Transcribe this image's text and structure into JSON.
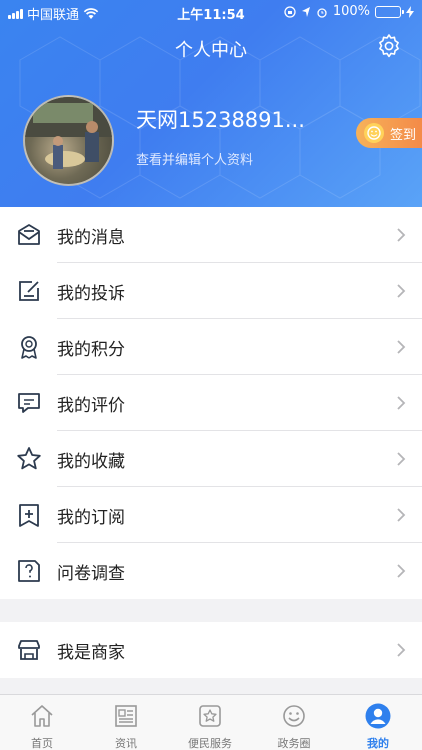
{
  "status_bar": {
    "carrier": "中国联通",
    "time": "上午11:54",
    "battery": "100%"
  },
  "header": {
    "title": "个人中心",
    "username": "天网15238891...",
    "edit_profile": "查看并编辑个人资料",
    "checkin_label": "签到"
  },
  "menu": {
    "items": [
      {
        "label": "我的消息",
        "icon": "message-icon"
      },
      {
        "label": "我的投诉",
        "icon": "complaint-icon"
      },
      {
        "label": "我的积分",
        "icon": "award-icon"
      },
      {
        "label": "我的评价",
        "icon": "comment-icon"
      },
      {
        "label": "我的收藏",
        "icon": "star-icon"
      },
      {
        "label": "我的订阅",
        "icon": "subscribe-icon"
      },
      {
        "label": "问卷调查",
        "icon": "survey-icon"
      }
    ],
    "merchant": {
      "label": "我是商家",
      "icon": "store-icon"
    }
  },
  "tabbar": {
    "tabs": [
      {
        "label": "首页",
        "icon": "home-icon"
      },
      {
        "label": "资讯",
        "icon": "news-icon"
      },
      {
        "label": "便民服务",
        "icon": "service-icon"
      },
      {
        "label": "政务圈",
        "icon": "smile-icon"
      },
      {
        "label": "我的",
        "icon": "profile-icon",
        "active": true
      }
    ]
  },
  "colors": {
    "header_gradient_start": "#3a84f0",
    "header_gradient_end": "#5aa3f7",
    "accent": "#2f80ed",
    "checkin_start": "#f6b25a",
    "checkin_end": "#f48a48"
  }
}
